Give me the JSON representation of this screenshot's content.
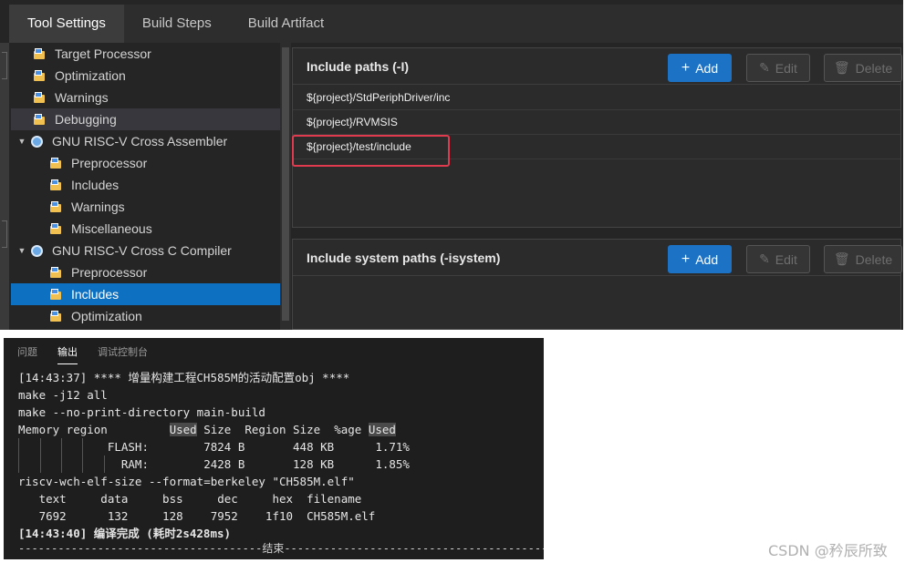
{
  "tabs": [
    {
      "label": "Tool Settings",
      "active": true
    },
    {
      "label": "Build Steps",
      "active": false
    },
    {
      "label": "Build Artifact",
      "active": false
    }
  ],
  "tree": [
    {
      "label": "Target Processor",
      "icon": "folder-icon",
      "state": "normal"
    },
    {
      "label": "Optimization",
      "icon": "folder-icon",
      "state": "normal"
    },
    {
      "label": "Warnings",
      "icon": "folder-icon",
      "state": "normal"
    },
    {
      "label": "Debugging",
      "icon": "folder-icon",
      "state": "hover"
    },
    {
      "label": "GNU RISC-V Cross Assembler",
      "icon": "gear-icon",
      "state": "expanded"
    },
    {
      "label": "Preprocessor",
      "icon": "folder-icon",
      "state": "normal"
    },
    {
      "label": "Includes",
      "icon": "folder-icon",
      "state": "normal"
    },
    {
      "label": "Warnings",
      "icon": "folder-icon",
      "state": "normal"
    },
    {
      "label": "Miscellaneous",
      "icon": "folder-icon",
      "state": "normal"
    },
    {
      "label": "GNU RISC-V Cross C Compiler",
      "icon": "gear-icon",
      "state": "expanded"
    },
    {
      "label": "Preprocessor",
      "icon": "folder-icon",
      "state": "normal"
    },
    {
      "label": "Includes",
      "icon": "folder-icon",
      "state": "selected"
    },
    {
      "label": "Optimization",
      "icon": "folder-icon",
      "state": "normal"
    }
  ],
  "include_paths": {
    "title": "Include paths (-I)",
    "add_label": "Add",
    "edit_label": "Edit",
    "delete_label": "Delete",
    "add_icon": "plus-icon",
    "edit_icon": "pencil-icon",
    "delete_icon": "trash-icon",
    "items": [
      "${project}/StdPeriphDriver/inc",
      "${project}/RVMSIS",
      "${project}/test/include"
    ]
  },
  "system_paths": {
    "title": "Include system paths (-isystem)",
    "add_label": "Add",
    "edit_label": "Edit",
    "delete_label": "Delete"
  },
  "terminal": {
    "tabs": [
      {
        "label": "问题",
        "active": false
      },
      {
        "label": "输出",
        "active": true
      },
      {
        "label": "调试控制台",
        "active": false
      }
    ],
    "lines": [
      "[14:43:37] **** 增量构建工程CH585M的活动配置obj ****",
      "make -j12 all",
      "make --no-print-directory main-build",
      "",
      "             FLASH:        7824 B       448 KB      1.71%",
      "               RAM:        2428 B       128 KB      1.85%",
      "riscv-wch-elf-size --format=berkeley \"CH585M.elf\"",
      "   text     data     bss     dec     hex  filename",
      "   7692      132     128    7952    1f10  CH585M.elf",
      "[14:43:40] 编译完成 (耗时2s428ms)"
    ],
    "memory_header": {
      "pre": "Memory region         ",
      "used1": "Used",
      "mid": " Size  Region Size  %age ",
      "used2": "Used"
    },
    "divider_label": "结束"
  },
  "watermark": "CSDN @矜辰所致",
  "colors": {
    "accent": "#0e70c0",
    "add_button": "#1c72c4",
    "highlight_box": "#e03a4e"
  }
}
